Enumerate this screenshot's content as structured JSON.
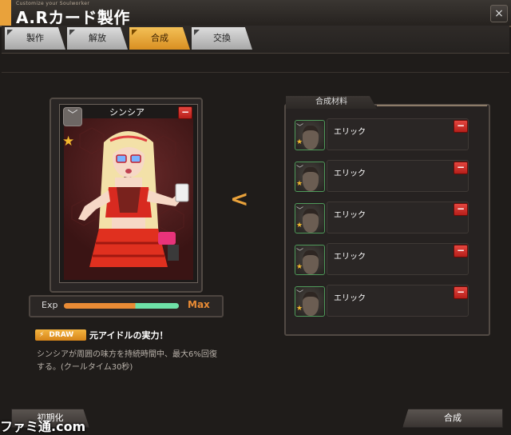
{
  "header": {
    "subtitle": "Customize your Soulworker",
    "title": "A.Rカード製作",
    "close_label": "×"
  },
  "tabs": [
    {
      "label": "製作",
      "active": false
    },
    {
      "label": "解放",
      "active": false
    },
    {
      "label": "合成",
      "active": true
    },
    {
      "label": "交換",
      "active": false
    }
  ],
  "card": {
    "name": "シンシア",
    "chevron": "﹀",
    "remove_label": "−",
    "rarity_icon": "star-icon",
    "exp_label": "Exp",
    "exp_level": 1.0,
    "exp_status": "Max"
  },
  "skill": {
    "badge_label": "DRAW",
    "badge_icon": "lightning-icon",
    "title": "元アイドルの実力！",
    "description": "シンシアが周囲の味方を持続時間中、最大6%回復する。(クールタイム30秒)"
  },
  "arrow": "<",
  "materials": {
    "header": "合成材料",
    "items": [
      {
        "name": "エリック",
        "remove_label": "−"
      },
      {
        "name": "エリック",
        "remove_label": "−"
      },
      {
        "name": "エリック",
        "remove_label": "−"
      },
      {
        "name": "エリック",
        "remove_label": "−"
      },
      {
        "name": "エリック",
        "remove_label": "−"
      }
    ]
  },
  "buttons": {
    "reset_label": "初期化",
    "synthesize_label": "合成"
  },
  "watermark": "ファミ通.com",
  "colors": {
    "accent": "#e9a23b",
    "exp_orange": "#e98b35",
    "exp_green": "#6ee1a7",
    "remove_red": "#d02f28"
  }
}
